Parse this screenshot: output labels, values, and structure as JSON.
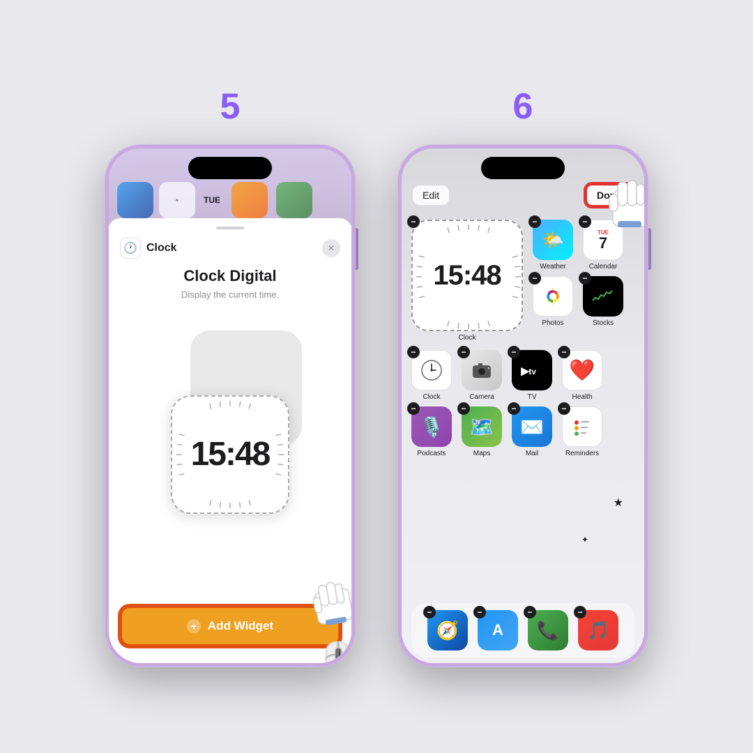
{
  "steps": {
    "step5": {
      "number": "5",
      "screen": {
        "app_name": "Clock",
        "widget_title": "Clock Digital",
        "widget_desc": "Display the current time.",
        "time_display": "15:48",
        "add_widget_label": "Add Widget"
      }
    },
    "step6": {
      "number": "6",
      "screen": {
        "edit_label": "Edit",
        "done_label": "Done",
        "time_display": "15:48",
        "apps": {
          "row1": [
            "Weather",
            "Calendar",
            "Clock"
          ],
          "row2": [
            "Photos",
            "Stocks"
          ],
          "row3": [
            "Clock",
            "Camera",
            "TV",
            "Health"
          ],
          "row4": [
            "Podcasts",
            "Maps",
            "Mail",
            "Reminders"
          ],
          "dock": [
            "Safari",
            "App Store",
            "Phone",
            "Music"
          ]
        }
      }
    }
  }
}
